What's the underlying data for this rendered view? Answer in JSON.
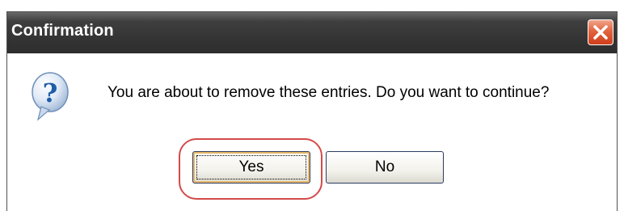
{
  "dialog": {
    "title": "Confirmation",
    "close_icon": "close-icon",
    "icon": "question-icon",
    "message": "You are about to remove these entries. Do you want to continue?",
    "buttons": {
      "yes_label": "Yes",
      "no_label": "No"
    },
    "colors": {
      "titlebar": "#353535",
      "close_button": "#e2633f",
      "highlight": "#d44a4a",
      "icon_blue": "#1f5ca8"
    }
  }
}
